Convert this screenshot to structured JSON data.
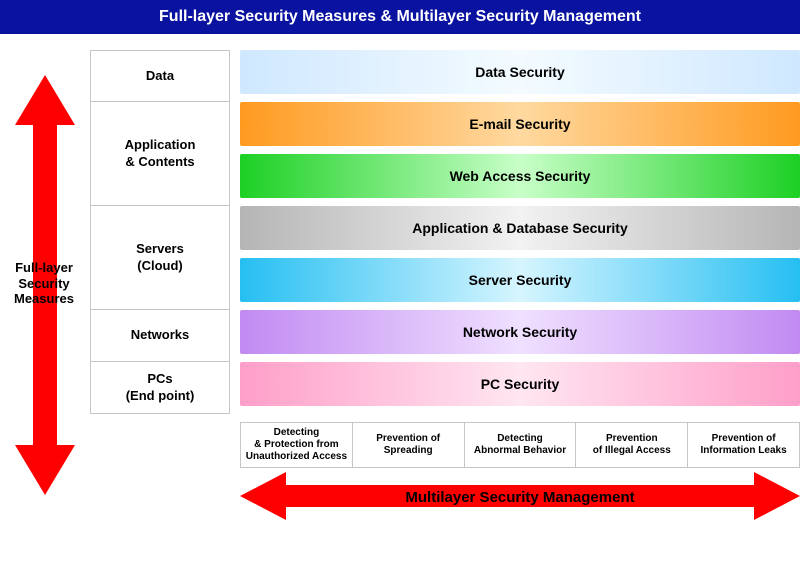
{
  "header": {
    "title": "Full-layer Security Measures & Multilayer Security Management"
  },
  "vertical_axis": {
    "line1": "Full-layer",
    "line2": "Security",
    "line3": "Measures"
  },
  "layers": [
    {
      "label": "Data",
      "rowspan": 1
    },
    {
      "label": "Application\n& Contents",
      "rowspan": 2
    },
    {
      "label": "Servers\n(Cloud)",
      "rowspan": 2
    },
    {
      "label": "Networks",
      "rowspan": 1
    },
    {
      "label": "PCs\n(End point)",
      "rowspan": 1
    }
  ],
  "bars": [
    {
      "label": "Data Security",
      "c1": "#cfe8ff",
      "c2": "#f4fbff"
    },
    {
      "label": "E-mail Security",
      "c1": "#ff9a1f",
      "c2": "#ffd9a0"
    },
    {
      "label": "Web Access Security",
      "c1": "#1dd024",
      "c2": "#c8ffc8"
    },
    {
      "label": "Application & Database Security",
      "c1": "#b5b5b5",
      "c2": "#f2f2f2"
    },
    {
      "label": "Server Security",
      "c1": "#26bff2",
      "c2": "#d6f5ff"
    },
    {
      "label": "Network Security",
      "c1": "#c18bf2",
      "c2": "#f0e0ff"
    },
    {
      "label": "PC Security",
      "c1": "#ff9fc9",
      "c2": "#ffe6f1"
    }
  ],
  "bottom": [
    "Detecting\n& Protection from\nUnauthorized Access",
    "Prevention of\nSpreading",
    "Detecting\nAbnormal Behavior",
    "Prevention\nof Illegal Access",
    "Prevention of\nInformation Leaks"
  ],
  "horizontal_axis": {
    "label": "Multilayer Security Management"
  },
  "colors": {
    "header_bg": "#0a12a0",
    "arrow": "#ff0000"
  }
}
